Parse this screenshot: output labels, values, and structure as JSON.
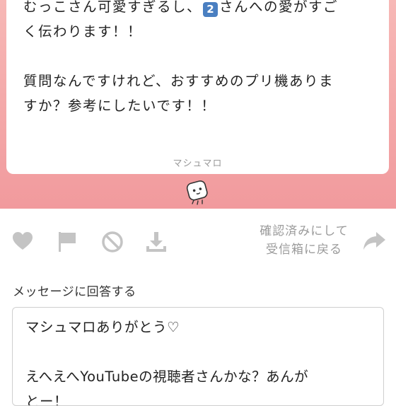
{
  "question": {
    "line1_before": "むっこさん可愛すぎるし、",
    "keycap": "2",
    "line1_after": "さんへの愛がすご",
    "line2": "く伝わります！！",
    "line3": "質問なんですけれど、おすすめのプリ機ありま",
    "line4": "すか？参考にしたいです！！"
  },
  "brand": "マシュマロ",
  "actions": {
    "like_icon": "heart-icon",
    "report_icon": "flag-icon",
    "block_icon": "block-icon",
    "download_icon": "download-icon",
    "restore_line1": "確認済みにして",
    "restore_line2": "受信箱に戻る",
    "share_icon": "share-arrow-icon"
  },
  "answer": {
    "label": "メッセージに回答する",
    "line1": "マシュマロありがとう♡",
    "line2": "えへえへYouTubeの視聴者さんかな？あんが",
    "line3": "とー！"
  },
  "colors": {
    "band_top": "#f7b8b6",
    "band_bottom": "#f19a9d",
    "icon_gray": "#c4c4c4",
    "muted_text": "#9a9a9a"
  }
}
